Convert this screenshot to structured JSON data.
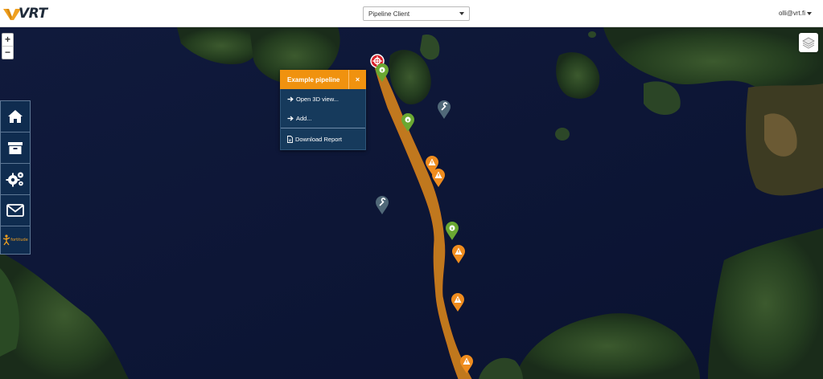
{
  "header": {
    "logo_text": "VRT",
    "client_select": "Pipeline Client",
    "user_menu": "olli@vrt.fi"
  },
  "map": {
    "zoom_in_label": "+",
    "zoom_out_label": "−",
    "layers_icon": "layers-icon"
  },
  "sidebar": {
    "items": [
      {
        "icon": "home-icon"
      },
      {
        "icon": "archive-icon"
      },
      {
        "icon": "gears-icon"
      },
      {
        "icon": "envelope-icon"
      },
      {
        "icon": "fortitude-logo",
        "label": "fortitude"
      }
    ]
  },
  "popup": {
    "title": "Example pipeline",
    "close_label": "×",
    "items": [
      {
        "label": "Open 3D view...",
        "icon": "arrow-right-icon"
      },
      {
        "label": "Add...",
        "icon": "arrow-right-icon"
      },
      {
        "label": "Download Report",
        "icon": "file-pdf-icon"
      }
    ]
  },
  "colors": {
    "pipeline_corridor": "#e08a1a",
    "info_marker": "#6aa832",
    "warning_marker": "#ef8c1e",
    "tool_marker": "#506878",
    "start_marker": "#d8202a",
    "sidebar_bg": "#0f2c4f",
    "popup_head": "#f0920f",
    "popup_body": "#163a5c"
  }
}
